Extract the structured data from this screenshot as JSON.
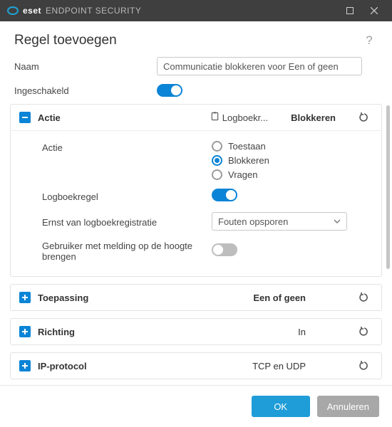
{
  "titlebar": {
    "brand_eset": "eset",
    "brand_product": "ENDPOINT SECURITY"
  },
  "header": {
    "title": "Regel toevoegen",
    "help": "?"
  },
  "fields": {
    "name_label": "Naam",
    "name_value": "Communicatie blokkeren voor Een of geen",
    "enabled_label": "Ingeschakeld"
  },
  "sections": {
    "action": {
      "title": "Actie",
      "log_label": "Logboekr...",
      "summary": "Blokkeren",
      "row_action_label": "Actie",
      "options": {
        "allow": "Toestaan",
        "block": "Blokkeren",
        "ask": "Vragen"
      },
      "log_rule_label": "Logboekregel",
      "severity_label": "Ernst van logboekregistratie",
      "severity_value": "Fouten opsporen",
      "notify_label": "Gebruiker met melding op de hoogte brengen"
    },
    "application": {
      "title": "Toepassing",
      "summary": "Een of geen"
    },
    "direction": {
      "title": "Richting",
      "summary": "In"
    },
    "ip_protocol": {
      "title": "IP-protocol",
      "summary": "TCP en UDP"
    }
  },
  "footer": {
    "ok": "OK",
    "cancel": "Annuleren"
  }
}
